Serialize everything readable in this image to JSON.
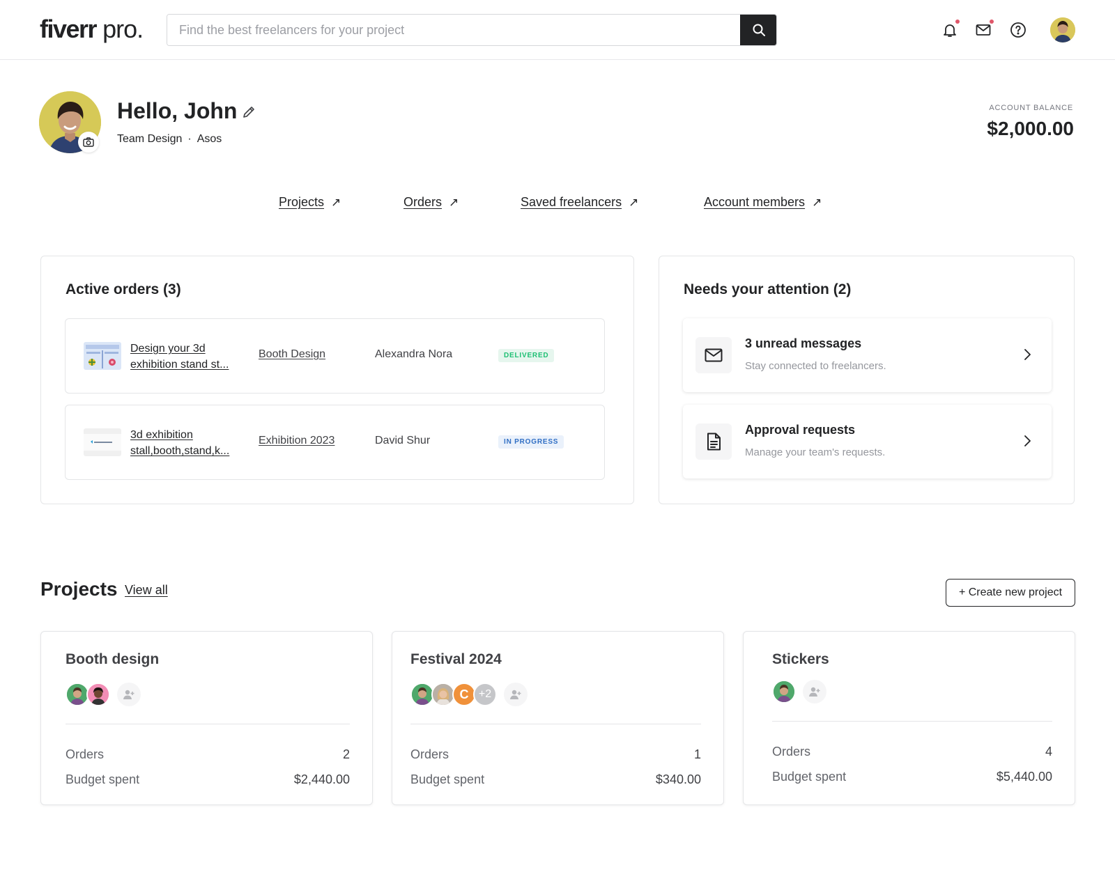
{
  "header": {
    "logo_main": "fiverr",
    "logo_suffix": " pro.",
    "search_placeholder": "Find the best freelancers for your project",
    "icons": [
      "bell-icon",
      "envelope-icon",
      "help-icon"
    ]
  },
  "profile": {
    "greeting": "Hello, John",
    "team": "Team Design",
    "separator": "·",
    "company": "Asos",
    "balance_label": "ACCOUNT BALANCE",
    "balance_value": "$2,000.00"
  },
  "quick_links": [
    {
      "label": "Projects"
    },
    {
      "label": "Orders"
    },
    {
      "label": "Saved freelancers"
    },
    {
      "label": "Account members"
    }
  ],
  "quick_link_arrow": "↗",
  "active_orders": {
    "title": "Active orders (3)",
    "rows": [
      {
        "name": "Design your 3d exhibition stand st...",
        "project": "Booth Design",
        "seller": "Alexandra Nora",
        "status": "DELIVERED"
      },
      {
        "name": "3d exhibition stall,booth,stand,k...",
        "project": "Exhibition 2023",
        "seller": "David Shur",
        "status": "IN PROGRESS"
      }
    ]
  },
  "attention": {
    "title": "Needs your attention (2)",
    "items": [
      {
        "title": "3 unread messages",
        "subtitle": "Stay connected to freelancers.",
        "icon": "envelope-icon"
      },
      {
        "title": "Approval requests",
        "subtitle": "Manage your team's requests.",
        "icon": "document-icon"
      }
    ]
  },
  "projects": {
    "heading": "Projects",
    "view_all": "View all",
    "create_label": "+ Create new project",
    "orders_label": "Orders",
    "budget_label": "Budget spent",
    "cards": [
      {
        "name": "Booth design",
        "orders": "2",
        "budget": "$2,440.00"
      },
      {
        "name": "Festival 2024",
        "orders": "1",
        "budget": "$340.00",
        "extra_initial": "C",
        "extra_count": "+2"
      },
      {
        "name": "Stickers",
        "orders": "4",
        "budget": "$5,440.00"
      }
    ]
  },
  "colors": {
    "text": "#222325",
    "delivered": "#1dbf73",
    "in_progress": "#2f6ec4",
    "notification_dot": "#e0576a",
    "avatar_orange": "#f0913a"
  }
}
